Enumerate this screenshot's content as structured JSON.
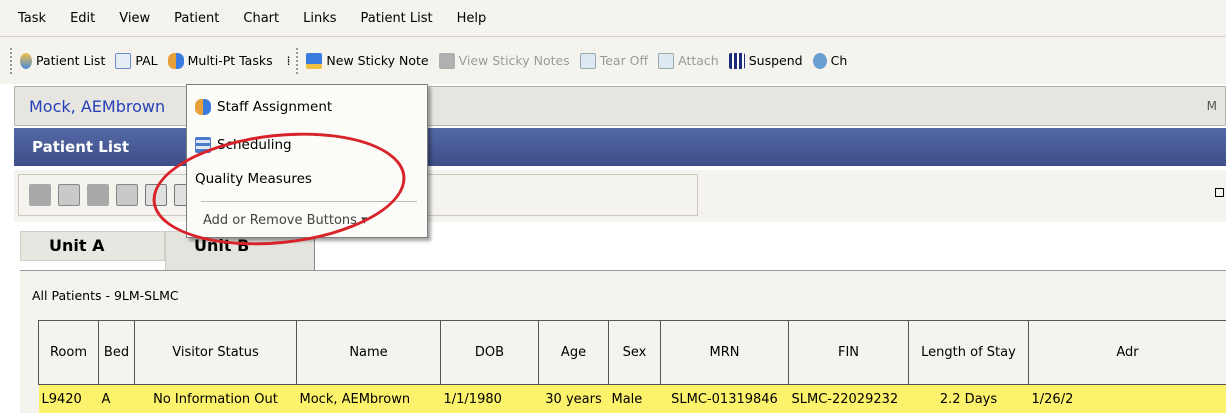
{
  "menubar": {
    "items": [
      "Task",
      "Edit",
      "View",
      "Patient",
      "Chart",
      "Links",
      "Patient List",
      "Help"
    ]
  },
  "toolbar": {
    "patient_list": "Patient List",
    "pal": "PAL",
    "multi_pt_tasks": "Multi-Pt Tasks",
    "new_sticky_note": "New Sticky Note",
    "view_sticky_notes": "View Sticky Notes",
    "tear_off": "Tear Off",
    "attach": "Attach",
    "suspend": "Suspend",
    "charges": "Ch"
  },
  "patient_bar": {
    "name": "Mock, AEMbrown",
    "right_text": "M"
  },
  "patient_list_header": {
    "title": "Patient List"
  },
  "dropdown": {
    "items": [
      "Staff Assignment",
      "Scheduling",
      "Quality Measures"
    ],
    "add_remove": "Add or Remove Buttons ▾"
  },
  "tabs": [
    "Unit A",
    "Unit B"
  ],
  "list_label": "All Patients - 9LM-SLMC",
  "table": {
    "columns": [
      "Room",
      "Bed",
      "Visitor Status",
      "Name",
      "DOB",
      "Age",
      "Sex",
      "MRN",
      "FIN",
      "Length of Stay",
      "Adr"
    ],
    "rows": [
      [
        "L9420",
        "A",
        "No Information Out",
        "Mock, AEMbrown",
        "1/1/1980",
        "30 years",
        "Male",
        "SLMC-01319846",
        "SLMC-22029232",
        "2.2 Days",
        "1/26/2"
      ]
    ]
  },
  "colors": {
    "header_blue": "#4a5a96",
    "row_highlight": "#fdf26b",
    "annotation_red": "#d8232a",
    "patient_name_blue": "#2640b8"
  }
}
